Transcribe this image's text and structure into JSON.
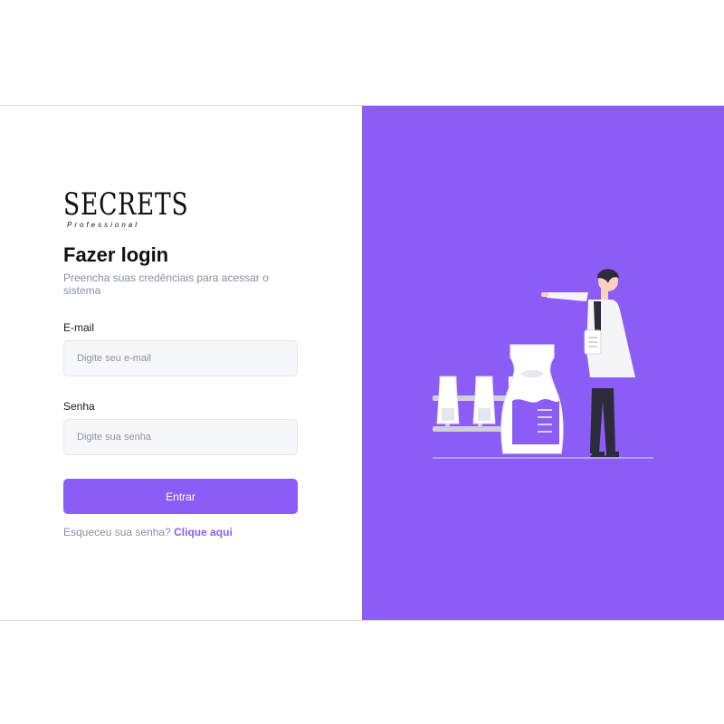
{
  "logo": {
    "word": "SECRETS",
    "sub": "Professional"
  },
  "login": {
    "title": "Fazer login",
    "subtitle": "Preencha suas credênciais para acessar o sistema",
    "email_label": "E-mail",
    "email_placeholder": "Digite seu e-mail",
    "password_label": "Senha",
    "password_placeholder": "Digite sua senha",
    "submit_label": "Entrar",
    "forgot_text": "Esqueceu sua senha?",
    "forgot_link": "Clique aqui"
  },
  "colors": {
    "accent": "#8b5cf6",
    "input_bg": "#f6f7fb",
    "muted_text": "#8a8fa3"
  },
  "illustration": {
    "icon": "scientist-lab-illustration"
  }
}
